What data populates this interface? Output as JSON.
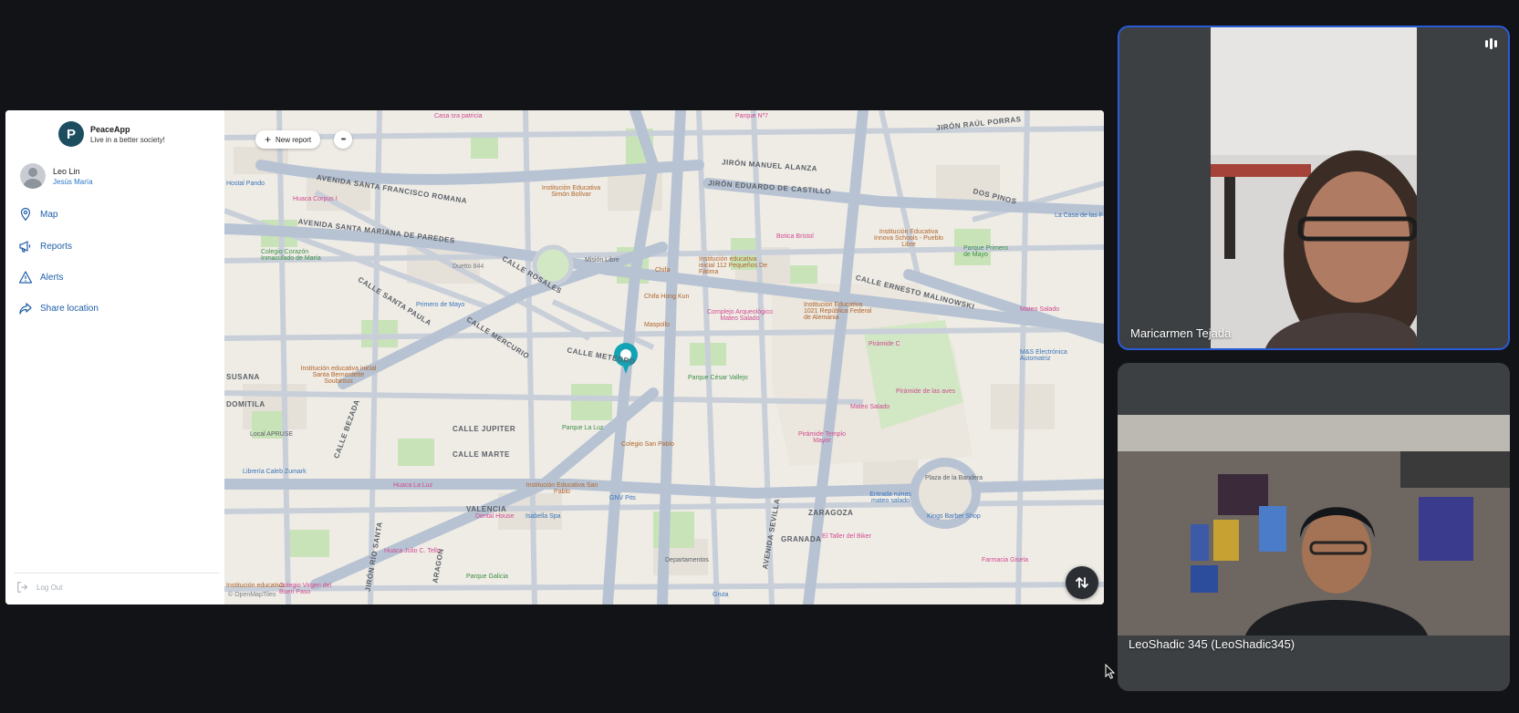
{
  "app": {
    "name": "PeaceApp",
    "tagline": "Live in a better society!",
    "logo_letter": "P",
    "brand_color": "#1d4e5f",
    "accent": "#2a77c9"
  },
  "user": {
    "name": "Leo Lin",
    "location": "Jesús María"
  },
  "nav": [
    {
      "label": "Map",
      "icon": "map-pin-icon"
    },
    {
      "label": "Reports",
      "icon": "megaphone-icon"
    },
    {
      "label": "Alerts",
      "icon": "warning-icon"
    },
    {
      "label": "Share location",
      "icon": "share-icon"
    }
  ],
  "logout_label": "Log Out",
  "map": {
    "new_report_label": "New report",
    "more_label": "•••",
    "attribution": "© OpenMapTiles",
    "streets": [
      "AVENIDA SANTA FRANCISCO ROMANA",
      "AVENIDA SANTA MARIANA DE PAREDES",
      "JIRÓN MANUEL ALANZA",
      "JIRÓN EDUARDO DE CASTILLO",
      "CALLE ROSALES",
      "CALLE SANTA PAULA",
      "CALLE MERCURIO",
      "CALLE METEORO",
      "CALLE JUPITER",
      "CALLE MARTE",
      "CALLE BEZADA",
      "CALLE ERNESTO MALINOWSKI",
      "VALENCIA",
      "GRANADA",
      "ZARAGOZA",
      "AVENIDA SEVILLA",
      "JIRÓN RÍO SANTA",
      "ARAGON",
      "DOS PINOS",
      "JIRÓN RAÚL PORRAS",
      "SUSANA",
      "DOMITILA"
    ],
    "pois": [
      "Casa sra patricia",
      "Parque Nº7",
      "Hostal Pando",
      "Huaca Corpus I",
      "Institución Educativa Simón Bolívar",
      "Colegio Corazón Inmaculado de María",
      "Duetto 844",
      "Misión Libre",
      "Chifa",
      "Chifa Hong Kun",
      "Maspollo",
      "Institución educativa inicial 112 Pequeños De Fátima",
      "Botica Bristol",
      "Complejo Arqueológico Mateo Salado",
      "Institución Educativa 1021 República Federal de Alemania",
      "Institución Educativa Innova Schools - Pueblo Libre",
      "Parque Primero de Mayo",
      "Primero de Mayo",
      "Pirámide C",
      "Pirámide de las aves",
      "Mateo Salado",
      "Pirámide Templo Mayor",
      "Institución educativa inicial Santa Bernardette Soubirous",
      "Parque César Vallejo",
      "Parque La Luz",
      "Colegio San Pablo",
      "Local APRUSE",
      "Librería Caleb Zumark",
      "Huaca La Luz",
      "Institución Educativa San Pablo",
      "GNV Pits",
      "Dental House",
      "Isabella Spa",
      "Huaca Julio C. Tello",
      "Parque Galicia",
      "Departamentos",
      "Gruta",
      "El Taller del Biker",
      "Entrada ruinas mateo salado",
      "Kings Barber Shop",
      "Plaza de la Bandera",
      "Farmacia Gisela",
      "Mateo Salado",
      "M&S Electrónica Automatriz",
      "La Casa de las F",
      "Colegio Virgen del Buen Paso",
      "Institución educativa"
    ]
  },
  "participants": [
    {
      "name": "Maricarmen Tejada",
      "speaking": true
    },
    {
      "name": "LeoShadic 345 (LeoShadic345)",
      "speaking": false
    }
  ]
}
